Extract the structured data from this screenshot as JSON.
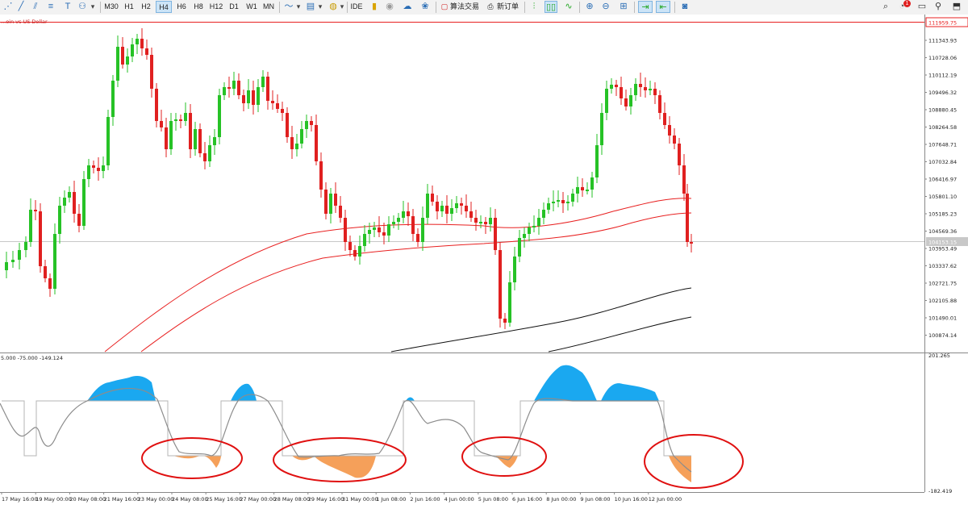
{
  "toolbar": {
    "timeframes": [
      "M30",
      "H1",
      "H2",
      "H4",
      "H6",
      "H8",
      "H12",
      "D1",
      "W1",
      "MN"
    ],
    "active_timeframe": "H4",
    "ide_label": "IDE",
    "algo_label": "算法交易",
    "new_order_label": "新订单",
    "notification_count": "1"
  },
  "chart": {
    "symbol_title": "...oin vs US Dollar",
    "current_price_tag": "111959.75",
    "bid_price_tag": "104153.15",
    "indicator_title": "5.000 -75.000 -149.124",
    "price_axis": [
      "111343.93",
      "110728.06",
      "110112.19",
      "109496.32",
      "108880.45",
      "108264.58",
      "107648.71",
      "107032.84",
      "106416.97",
      "105801.10",
      "105185.23",
      "104569.36",
      "103953.49",
      "103337.62",
      "102721.75",
      "102105.88",
      "101490.01",
      "100874.14"
    ],
    "indicator_axis": [
      "201.265",
      "-182.419"
    ],
    "time_axis": [
      "17 May 16:00",
      "19 May 00:00",
      "20 May 08:00",
      "21 May 16:00",
      "23 May 00:00",
      "24 May 08:00",
      "25 May 16:00",
      "27 May 00:00",
      "28 May 08:00",
      "29 May 16:00",
      "31 May 00:00",
      "1 Jun 08:00",
      "2 Jun 16:00",
      "4 Jun 00:00",
      "5 Jun 08:00",
      "6 Jun 16:00",
      "8 Jun 00:00",
      "9 Jun 08:00",
      "10 Jun 16:00",
      "12 Jun 00:00"
    ],
    "colors": {
      "bull": "#26c226",
      "bear": "#e02020",
      "ma_red": "#e82020",
      "ma_black": "#111111",
      "osc_positive": "#1aa8f0",
      "osc_negative": "#f5a05a",
      "highlight_ellipse": "#e01010"
    }
  }
}
